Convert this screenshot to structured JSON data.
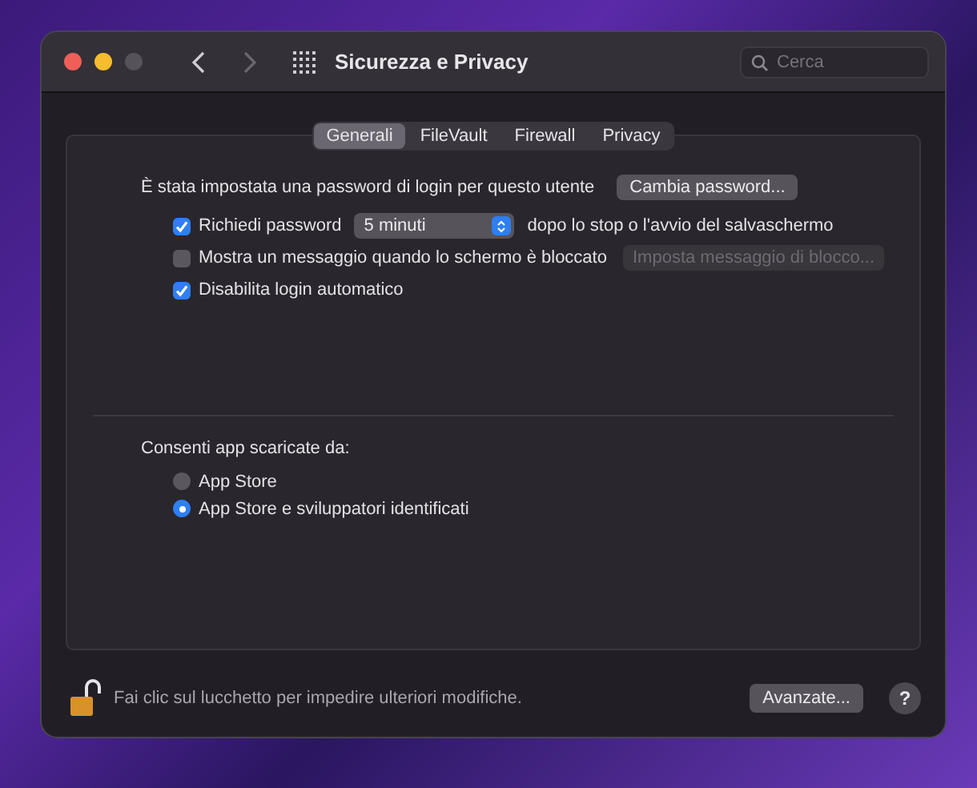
{
  "window": {
    "title": "Sicurezza e Privacy"
  },
  "search": {
    "placeholder": "Cerca"
  },
  "tabs": [
    {
      "label": "Generali",
      "selected": true
    },
    {
      "label": "FileVault",
      "selected": false
    },
    {
      "label": "Firewall",
      "selected": false
    },
    {
      "label": "Privacy",
      "selected": false
    }
  ],
  "password": {
    "text": "È stata impostata una password di login per questo utente",
    "button": "Cambia password..."
  },
  "options": [
    {
      "kind": "select",
      "label": "Richiedi password",
      "checked": true,
      "value": "5 minuti",
      "suffix": "dopo lo stop o l'avvio del salvaschermo"
    },
    {
      "kind": "button",
      "label": "Mostra un messaggio quando lo schermo è bloccato",
      "checked": false,
      "button": "Imposta messaggio di blocco...",
      "disabled": true
    },
    {
      "kind": "plain",
      "label": "Disabilita login automatico",
      "checked": true
    }
  ],
  "downloads": {
    "title": "Consenti app scaricate da:",
    "options": [
      {
        "label": "App Store",
        "selected": false
      },
      {
        "label": "App Store e sviluppatori identificati",
        "selected": true
      }
    ]
  },
  "footer": {
    "locked": false,
    "text": "Fai clic sul lucchetto per impedire ulteriori modifiche.",
    "advanced": "Avanzate...",
    "help": "?"
  }
}
